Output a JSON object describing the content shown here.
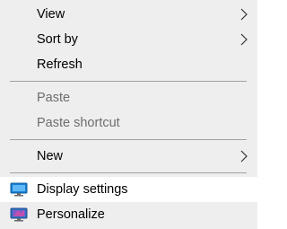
{
  "menu": {
    "items": [
      {
        "label": "View",
        "has_submenu": true
      },
      {
        "label": "Sort by",
        "has_submenu": true
      },
      {
        "label": "Refresh"
      },
      {
        "label": "Paste",
        "disabled": true
      },
      {
        "label": "Paste shortcut",
        "disabled": true
      },
      {
        "label": "New",
        "has_submenu": true
      },
      {
        "label": "Display settings",
        "icon": "display-settings-icon",
        "hovered": true
      },
      {
        "label": "Personalize",
        "icon": "personalize-icon"
      }
    ]
  },
  "colors": {
    "background": "#eeeeee",
    "hover": "#ffffff",
    "separator": "#a0a0a0",
    "disabled_text": "#6d6d6d"
  }
}
